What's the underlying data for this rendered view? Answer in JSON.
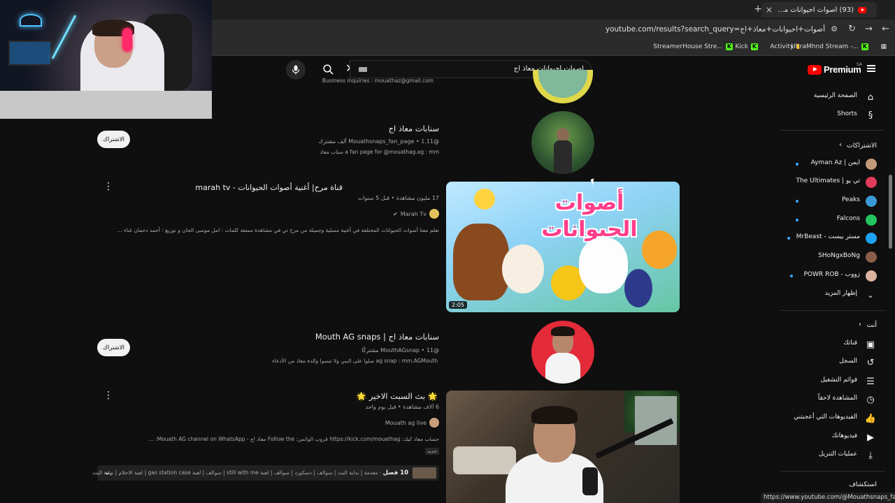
{
  "browser": {
    "tab_title": "(93) أصوات احيوانات معاذ اج - ",
    "tab_close": "×",
    "new_tab": "+",
    "url": "youtube.com/results?search_query=أصوات+احيوانات+معاذ+اج",
    "bookmarks": [
      {
        "label": "UltraMhnd Stream -...",
        "icon": "kick"
      },
      {
        "label": "Activity",
        "icon": "chart"
      },
      {
        "label": "Kick",
        "icon": "kick"
      },
      {
        "label": "StreamerHouse Stre...",
        "icon": "kick"
      }
    ]
  },
  "youtube": {
    "logo_text": "Premium",
    "logo_region": "SA",
    "search_query": "اصوات احيوانات معاذ اج"
  },
  "sidebar": {
    "main": [
      {
        "label": "الصفحة الرئيسية",
        "icon": "home-icon"
      },
      {
        "label": "Shorts",
        "icon": "shorts-icon"
      }
    ],
    "subscriptions_heading": "الاشتراكات",
    "subscriptions": [
      {
        "label": "ايمن | Ayman Az",
        "color": "#c49a7a"
      },
      {
        "label": "تي يو | The Ultimates",
        "color": "#e03c5a"
      },
      {
        "label": "Peaks",
        "color": "#3a9ad9"
      },
      {
        "label": "Falcons",
        "color": "#22c55e"
      },
      {
        "label": "مستر بيست - MrBeast",
        "color": "#1da1f2"
      },
      {
        "label": "SHoNgxBoNg",
        "color": "#8b5e4a"
      },
      {
        "label": "زووب - POWR ROB",
        "color": "#d9b3a0"
      }
    ],
    "show_more": "إظهار المزيد",
    "you_heading": "أنت",
    "you": [
      {
        "label": "قناتك",
        "icon": "account-icon"
      },
      {
        "label": "السجل",
        "icon": "history-icon"
      },
      {
        "label": "قوائم التشغيل",
        "icon": "playlist-icon"
      },
      {
        "label": "المشاهدة لاحقاً",
        "icon": "clock-icon"
      },
      {
        "label": "الفيديوهات التي أعجبتني",
        "icon": "like-icon"
      },
      {
        "label": "فيديوهاتك",
        "icon": "video-icon"
      },
      {
        "label": "عمليات التنزيل",
        "icon": "download-icon"
      }
    ],
    "explore_heading": "استكشاف"
  },
  "results": {
    "top_desc": "Business inquiries : mouathaz@gmail.com",
    "channel1": {
      "name": "سنابات معاذ اج",
      "handle": "@Mouathsnaps_fan_page",
      "subs": "1.11 ألف مشترك",
      "desc": "a fan page for @mouathag.ag : mm سناب معاذ",
      "subscribe": "الاشتراك"
    },
    "video1": {
      "title": "قناة مرح| أغنية أصوات الحيوانات - marah tv",
      "meta": "17 مليون مشاهدة • قبل 5 سنوات",
      "channel": "Marah Tv",
      "desc": "تعلم معنا أصوات الحيوانات المختلفة في أغنية مسلية وجميلة من مرح تي في مشاهدة ممتعة كلمات : امل موسى الحان و توزيع : أحمد دحمان غناء ...",
      "thumb_title": "أصوات الحيوانات",
      "duration": "2:05"
    },
    "channel2": {
      "name": "سنابات معاذ اج | Mouth AG snaps",
      "handle": "@MouthAGsnap",
      "subs": "11 مشتركًا",
      "desc": "ag snap : mm.AGMouth صلوا على النبي ولا تنسوا والدة معاذ من الأدعاء",
      "subscribe": "الاشتراك"
    },
    "video2": {
      "title": "🌟 بث السبت الاخير 🌟",
      "meta": "6 آلاف مشاهدة • قبل يوم واحد",
      "channel": "Mouath ag live",
      "desc": "حساب معاذ كيك: https://kick.com/mouathag قروب الواتس: Follow the معاذ اج - Mouath AG channel on WhatsApp: ...",
      "badge": "جديد",
      "chapters_count": "10 فصل",
      "chapters_text": "مقدمة | بداية البث | سوالف | دسكورد | سوالف | لعبة still with me | سوالف | لعبة gas station case | لعبة الاحلام | نهاية البث"
    }
  },
  "status_url": "https://www.youtube.com/@Mouathsnaps_fan_page"
}
